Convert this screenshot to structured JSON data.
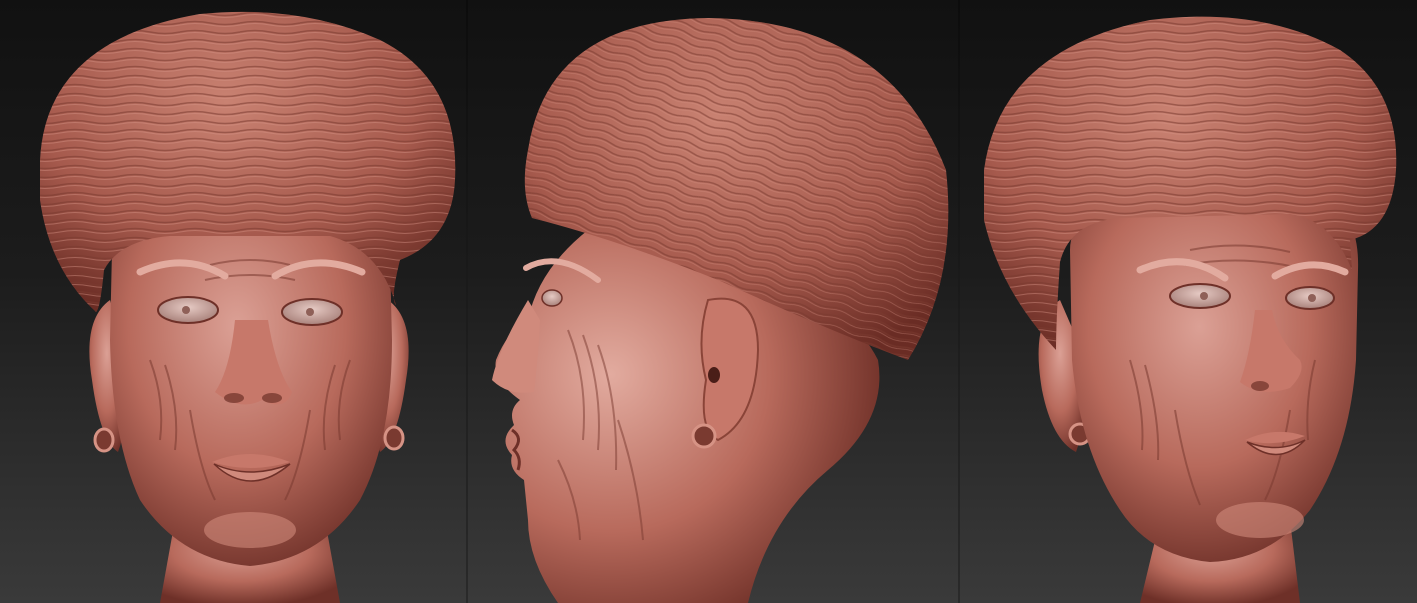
{
  "scene": {
    "kind": "3D sculpt render triptych",
    "views": [
      "front",
      "profile-left",
      "three-quarter"
    ],
    "colors": {
      "clay": "#b86a5c",
      "clay_shadow": "#6e3028",
      "clay_highlight": "#dba095",
      "hat": "#a65a4d",
      "hat_shadow": "#6a2c24",
      "eye_white": "#cfb0aa",
      "background_top": "#111111",
      "background_bottom": "#3a3a3a"
    }
  }
}
